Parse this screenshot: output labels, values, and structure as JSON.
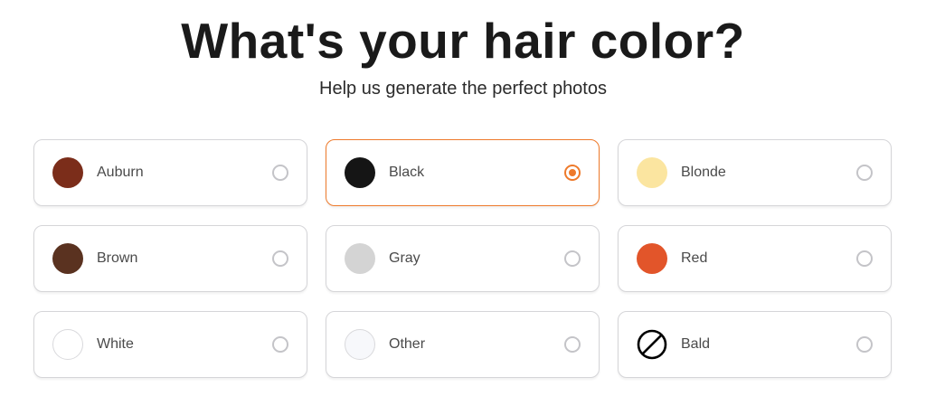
{
  "header": {
    "title": "What's your hair color?",
    "subtitle": "Help us generate the perfect photos"
  },
  "accent_color": "#ee7a2b",
  "selected": "Black",
  "options": [
    {
      "label": "Auburn",
      "color": "#7b2d1a",
      "icon": "auburn-swatch",
      "checked": false
    },
    {
      "label": "Black",
      "color": "#151515",
      "icon": "black-swatch",
      "checked": true
    },
    {
      "label": "Blonde",
      "color": "#fbe5a0",
      "icon": "blonde-swatch",
      "checked": false
    },
    {
      "label": "Brown",
      "color": "#5a3220",
      "icon": "brown-swatch",
      "checked": false
    },
    {
      "label": "Gray",
      "color": "#d4d4d4",
      "icon": "gray-swatch",
      "checked": false
    },
    {
      "label": "Red",
      "color": "#e2552a",
      "icon": "red-swatch",
      "checked": false
    },
    {
      "label": "White",
      "color": "#ffffff",
      "icon": "white-swatch",
      "checked": false
    },
    {
      "label": "Other",
      "color": "#f7f8fb",
      "icon": "other-swatch",
      "checked": false
    },
    {
      "label": "Bald",
      "color": "#000000",
      "icon": "no-symbol-icon",
      "checked": false
    }
  ]
}
